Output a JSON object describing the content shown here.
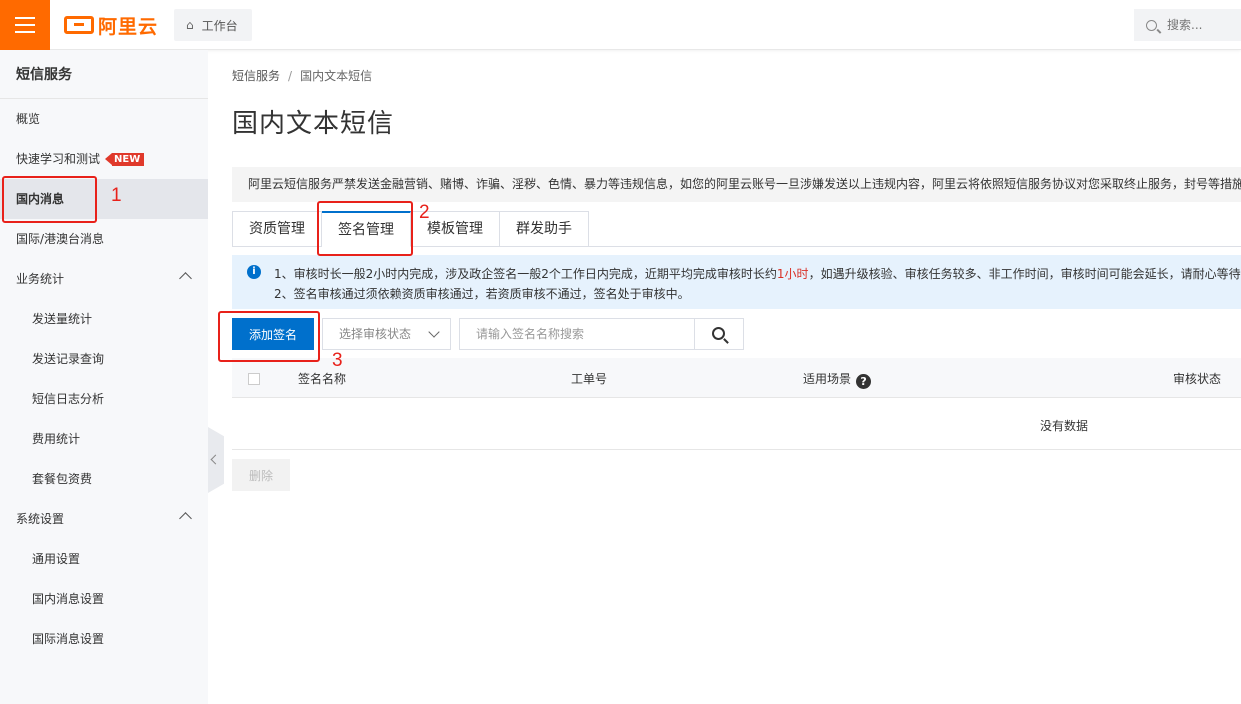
{
  "header": {
    "logo_text": "阿里云",
    "workbench_label": "工作台",
    "search_placeholder": "搜索..."
  },
  "sidebar": {
    "title": "短信服务",
    "items": [
      {
        "label": "概览"
      },
      {
        "label": "快速学习和测试",
        "badge": "NEW"
      },
      {
        "label": "国内消息",
        "active": true
      },
      {
        "label": "国际/港澳台消息"
      },
      {
        "label": "业务统计",
        "group": true
      },
      {
        "label": "发送量统计"
      },
      {
        "label": "发送记录查询"
      },
      {
        "label": "短信日志分析"
      },
      {
        "label": "费用统计"
      },
      {
        "label": "套餐包资费"
      },
      {
        "label": "系统设置",
        "group": true
      },
      {
        "label": "通用设置"
      },
      {
        "label": "国内消息设置"
      },
      {
        "label": "国际消息设置"
      }
    ]
  },
  "breadcrumb": [
    "短信服务",
    "国内文本短信"
  ],
  "breadcrumb_sep": "/",
  "page_title": "国内文本短信",
  "notice": "阿里云短信服务严禁发送金融营销、赌博、诈骗、淫秽、色情、暴力等违规信息，如您的阿里云账号一旦涉嫌发送以上违规内容，阿里云将依照短信服务协议对您采取终止服务，封号等措施",
  "tabs": [
    {
      "label": "资质管理",
      "active": false
    },
    {
      "label": "签名管理",
      "active": true
    },
    {
      "label": "模板管理",
      "active": false
    },
    {
      "label": "群发助手",
      "active": false
    }
  ],
  "tips": {
    "line1_a": "1、审核时长一般2小时内完成，涉及政企签名一般2个工作日内完成，近期平均完成审核时长约",
    "line1_highlight": "1小时",
    "line1_b": "，如遇升级核验、审核任务较多、非工作时间，审核时间可能会延长，请耐心等待。",
    "line2": "2、签名审核通过须依赖资质审核通过，若资质审核不通过，签名处于审核中。"
  },
  "toolbar": {
    "add_label": "添加签名",
    "status_placeholder": "选择审核状态",
    "search_placeholder": "请输入签名名称搜索"
  },
  "table": {
    "columns": [
      "签名名称",
      "工单号",
      "适用场景",
      "审核状态"
    ],
    "empty_text": "没有数据"
  },
  "delete_label": "删除",
  "annotations": [
    {
      "number": "1",
      "target": "国内消息"
    },
    {
      "number": "2",
      "target": "签名管理"
    },
    {
      "number": "3",
      "target": "添加签名"
    }
  ],
  "colors": {
    "brand": "#ff6a00",
    "primary": "#0070cc",
    "annotation": "#e8211a",
    "badge": "#e0392b"
  }
}
